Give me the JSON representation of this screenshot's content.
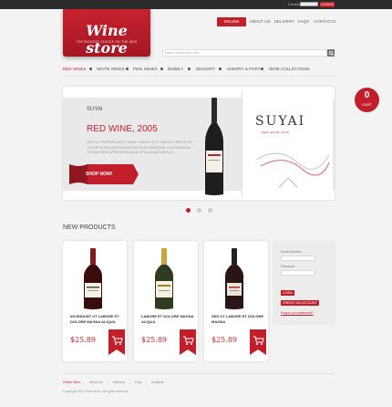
{
  "topbar": {
    "currency_label": "Currency: ",
    "currency_value": "",
    "change_label": "CHANGE"
  },
  "logo": {
    "title": "Wine store",
    "subtitle": "THE BIGGEST CHOICE ON THE WEB"
  },
  "topnav": [
    {
      "label": "ONLINE STORE",
      "active": true
    },
    {
      "label": "ABOUT US",
      "active": false
    },
    {
      "label": "DELIVERY",
      "active": false
    },
    {
      "label": "FAQS",
      "active": false
    },
    {
      "label": "CONTACTS",
      "active": false
    }
  ],
  "search": {
    "placeholder": "Search entire store here"
  },
  "categories": [
    "RED WINES",
    "WHITE WINES",
    "PINK WINES",
    "BUBBLY",
    "DESSERT",
    "SHERRY & PORT",
    "WINE COLLECTIONS"
  ],
  "active_category": "RED WINES",
  "slider": {
    "brand": "SUYAI",
    "title": "RED WINE, 2005",
    "description": "SED UT PERSPICIATIS UNDE OMNIS ISTE NATUS ERROR SIT VOLUPTATEM ACCUSANTIUM DOLOREMQUE LAUDANTIUM, TOTAM REM APERIAM EAQUE IPSA QUAE AB ILLO.",
    "button": "SHOP NOW!",
    "label_big": "SUYAI",
    "label_small": "RED WINE 2005",
    "dots": 3,
    "active_dot": 0
  },
  "cart": {
    "count": "0",
    "label": "CART"
  },
  "products_title": "NEW PRODUCTS",
  "products": [
    {
      "name": "INCIDIDUNT UT LABORE ET DOLORE MAGNA ALIQUA",
      "price": "$25.89",
      "bottle": "red"
    },
    {
      "name": "LABORE ET DOLORE MAGNA ALIQUA",
      "price": "$25.89",
      "bottle": "white"
    },
    {
      "name": "SED UT LABORE ET DOLORE MAGNA",
      "price": "$25.89",
      "bottle": "red"
    }
  ],
  "login": {
    "email_label": "Email Address",
    "password_label": "Password",
    "login_button": "LOGIN",
    "create_button": "CREATE AN ACCOUNT",
    "forgot": "Forgot your password?"
  },
  "footer": {
    "links": [
      "Online Store",
      "About Us",
      "Delivery",
      "Faqs",
      "Contacts"
    ],
    "active": "Online Store",
    "copyright": "Copyright 2012 Wine store. All rights reserved."
  },
  "colors": {
    "accent": "#c21f2b",
    "background": "#f3f3f3",
    "dark_bar": "#2b2b2b"
  }
}
